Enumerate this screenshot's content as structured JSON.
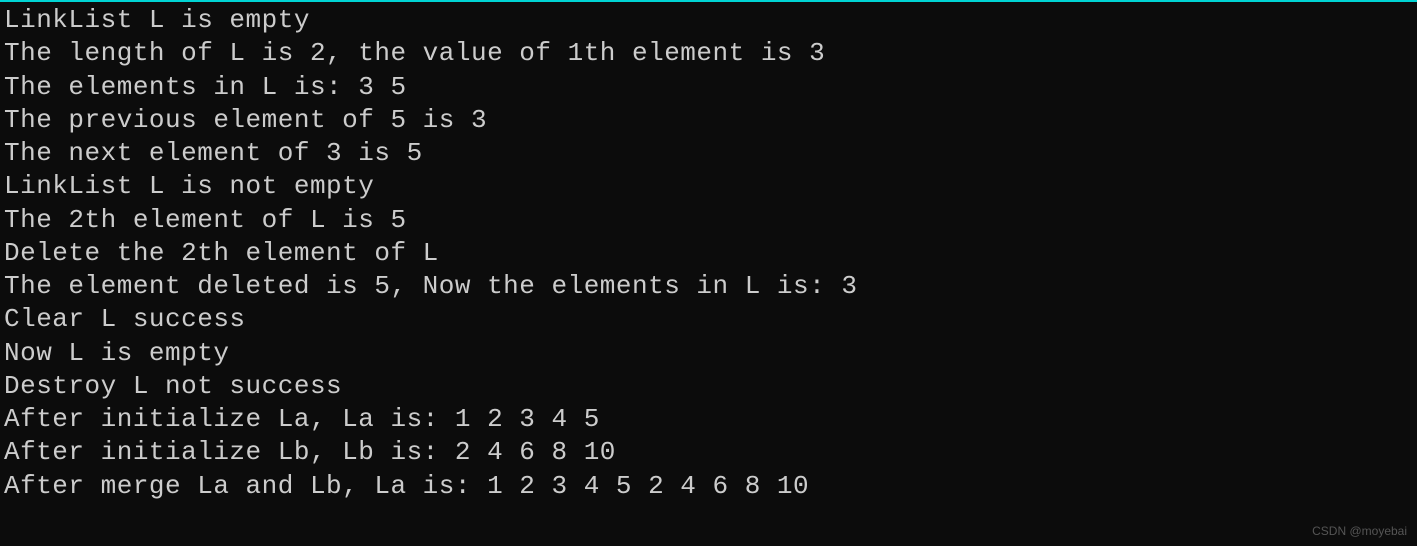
{
  "terminal": {
    "lines": [
      "LinkList L is empty",
      "The length of L is 2, the value of 1th element is 3",
      "The elements in L is: 3 5",
      "The previous element of 5 is 3",
      "The next element of 3 is 5",
      "LinkList L is not empty",
      "The 2th element of L is 5",
      "Delete the 2th element of L",
      "The element deleted is 5, Now the elements in L is: 3",
      "Clear L success",
      "Now L is empty",
      "Destroy L not success",
      "After initialize La, La is: 1 2 3 4 5",
      "After initialize Lb, Lb is: 2 4 6 8 10",
      "After merge La and Lb, La is: 1 2 3 4 5 2 4 6 8 10"
    ]
  },
  "watermark": "CSDN @moyebai"
}
